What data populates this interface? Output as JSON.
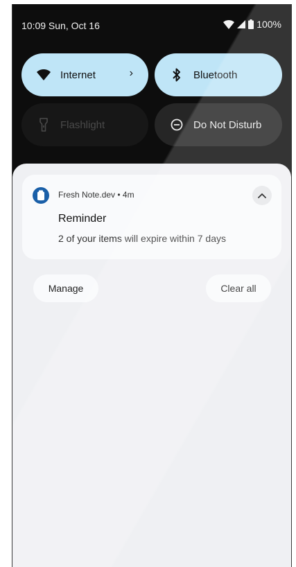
{
  "status_bar": {
    "time_date": "10:09 Sun, Oct 16",
    "battery": "100%",
    "icons": [
      "wifi-icon",
      "cellular-signal-icon",
      "battery-icon"
    ]
  },
  "quick_settings": {
    "tiles": [
      {
        "label": "Internet",
        "icon": "wifi-icon",
        "state": "on",
        "has_chevron": true
      },
      {
        "label": "Bluetooth",
        "icon": "bluetooth-icon",
        "state": "on"
      },
      {
        "label": "Flashlight",
        "icon": "flashlight-icon",
        "state": "unavailable"
      },
      {
        "label": "Do Not Disturb",
        "icon": "do-not-disturb-icon",
        "state": "off"
      }
    ],
    "chevron": "›"
  },
  "notification": {
    "app_name": "Fresh Note.dev • 4m",
    "title": "Reminder",
    "body": "2 of your items will expire within 7 days",
    "app_icon": "fresh-note-app-icon",
    "expand_icon": "chevron-up-icon"
  },
  "actions": {
    "manage": "Manage",
    "clear_all": "Clear all"
  },
  "colors": {
    "tile_active": "#bfe5f7",
    "tile_inactive": "#262626",
    "shade_background": "#eff0f3",
    "app_icon_blue": "#1a5fa8"
  }
}
